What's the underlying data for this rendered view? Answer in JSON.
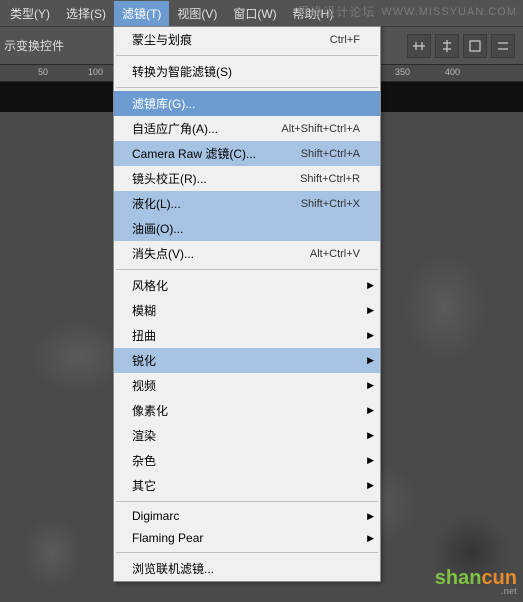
{
  "menubar": {
    "items": [
      {
        "label": "类型(Y)"
      },
      {
        "label": "选择(S)"
      },
      {
        "label": "滤镜(T)"
      },
      {
        "label": "视图(V)"
      },
      {
        "label": "窗口(W)"
      },
      {
        "label": "帮助(H)"
      }
    ]
  },
  "watermark": {
    "cn": "思缘设计论坛",
    "en": "WWW.MISSYUAN.COM"
  },
  "toolbar": {
    "label": "示变换控件"
  },
  "ruler": {
    "ticks": [
      "50",
      "100",
      "350",
      "400"
    ]
  },
  "dropdown": {
    "items": [
      {
        "label": "蒙尘与划痕",
        "shortcut": "Ctrl+F",
        "type": "item"
      },
      {
        "type": "sep"
      },
      {
        "label": "转换为智能滤镜(S)",
        "type": "item"
      },
      {
        "type": "sep"
      },
      {
        "label": "滤镜库(G)...",
        "type": "item",
        "hl": "blue"
      },
      {
        "label": "自适应广角(A)...",
        "shortcut": "Alt+Shift+Ctrl+A",
        "type": "item"
      },
      {
        "label": "Camera Raw 滤镜(C)...",
        "shortcut": "Shift+Ctrl+A",
        "type": "item",
        "hl": "light"
      },
      {
        "label": "镜头校正(R)...",
        "shortcut": "Shift+Ctrl+R",
        "type": "item"
      },
      {
        "label": "液化(L)...",
        "shortcut": "Shift+Ctrl+X",
        "type": "item",
        "hl": "light"
      },
      {
        "label": "油画(O)...",
        "type": "item",
        "hl": "light"
      },
      {
        "label": "消失点(V)...",
        "shortcut": "Alt+Ctrl+V",
        "type": "item"
      },
      {
        "type": "sep"
      },
      {
        "label": "风格化",
        "type": "sub"
      },
      {
        "label": "模糊",
        "type": "sub"
      },
      {
        "label": "扭曲",
        "type": "sub"
      },
      {
        "label": "锐化",
        "type": "sub",
        "hl": "light"
      },
      {
        "label": "视频",
        "type": "sub"
      },
      {
        "label": "像素化",
        "type": "sub"
      },
      {
        "label": "渲染",
        "type": "sub"
      },
      {
        "label": "杂色",
        "type": "sub"
      },
      {
        "label": "其它",
        "type": "sub"
      },
      {
        "type": "sep"
      },
      {
        "label": "Digimarc",
        "type": "sub"
      },
      {
        "label": "Flaming Pear",
        "type": "sub"
      },
      {
        "type": "sep"
      },
      {
        "label": "浏览联机滤镜...",
        "type": "item"
      }
    ]
  },
  "logo": {
    "sh": "shan",
    "cun": "cun",
    "net": ".net"
  }
}
